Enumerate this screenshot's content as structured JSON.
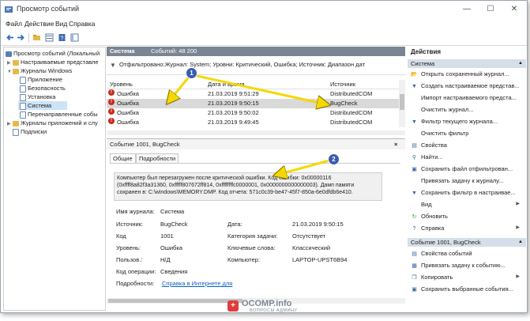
{
  "window": {
    "title": "Просмотр событий"
  },
  "menu": [
    "Файл",
    "Действие",
    "Вид",
    "Справка"
  ],
  "tree": {
    "root": "Просмотр событий (Локальный",
    "custom": "Настраиваемые представле",
    "windows_logs": "Журналы Windows",
    "app": "Приложение",
    "security": "Безопасность",
    "setup": "Установка",
    "system": "Система",
    "forwarded": "Перенаправленные собы",
    "apps_services": "Журналы приложений и слу",
    "subscriptions": "Подписки"
  },
  "center": {
    "log_name": "Система",
    "event_count": "Событий: 48 200",
    "filter": "Отфильтровано:Журнал: System; Уровни: Критический, Ошибка; Источник: Диапазон дат",
    "columns": {
      "level": "Уровень",
      "date": "Дата и время",
      "source": "Источник"
    },
    "rows": [
      {
        "level": "Ошибка",
        "date": "21.03.2019 9:51:29",
        "source": "DistributedCOM"
      },
      {
        "level": "Ошибка",
        "date": "21.03.2019 9:50:15",
        "source": "BugCheck"
      },
      {
        "level": "Ошибка",
        "date": "21.03.2019 9:50:02",
        "source": "DistributedCOM"
      },
      {
        "level": "Ошибка",
        "date": "21.03.2019 9:49:45",
        "source": "DistributedCOM"
      }
    ]
  },
  "detail": {
    "title": "Событие 1001, BugCheck",
    "close": "×",
    "tabs": [
      "Общие",
      "Подробности"
    ],
    "description": "Компьютер был перезагружен после критической ошибки. Код ошибки: 0x00000116 (0xffff8a82f3a31360, 0xfffff807672ff814, 0xffffffffc0000001, 0x0000000000000003). Дамп памяти сохранен в: C:\\windows\\MEMORY.DMP. Код отчета: 571c0c39-be47-45f7-850a-6e0dfdb6e410.",
    "fields": {
      "log_label": "Имя журнала:",
      "log_value": "Система",
      "source_label": "Источник:",
      "source_value": "BugCheck",
      "date_label": "Дата:",
      "date_value": "21.03.2019 9:50:15",
      "code_label": "Код",
      "code_value": "1001",
      "category_label": "Категория задачи:",
      "category_value": "Отсутствует",
      "level_label": "Уровень:",
      "level_value": "Ошибка",
      "keywords_label": "Ключевые слова:",
      "keywords_value": "Классический",
      "user_label": "Пользов.:",
      "user_value": "Н/Д",
      "computer_label": "Компьютер:",
      "computer_value": "LAPTOP-UPST6B94",
      "opcode_label": "Код операции:",
      "opcode_value": "Сведения",
      "more_label": "Подробности:",
      "more_link": "Справка в Интернете для"
    }
  },
  "actions": {
    "header": "Действия",
    "section1": "Система",
    "items1": [
      {
        "icon": "open-icon",
        "label": "Открыть сохраненный журнал..."
      },
      {
        "icon": "filter-create-icon",
        "label": "Создать настраиваемое представ..."
      },
      {
        "icon": "import-icon",
        "label": "Импорт настраиваемого предста..."
      },
      {
        "icon": "clear-icon",
        "label": "Очистить журнал..."
      },
      {
        "icon": "filter-icon",
        "label": "Фильтр текущего журнала..."
      },
      {
        "icon": "clear-filter-icon",
        "label": "Очистить фильтр"
      },
      {
        "icon": "properties-icon",
        "label": "Свойства"
      },
      {
        "icon": "find-icon",
        "label": "Найти..."
      },
      {
        "icon": "save-icon",
        "label": "Сохранить файл отфильтрован..."
      },
      {
        "icon": "attach-task-icon",
        "label": "Привязать задачу к журналу..."
      },
      {
        "icon": "save-filter-icon",
        "label": "Сохранить фильтр в настраиваe..."
      },
      {
        "icon": "view-icon",
        "label": "Вид"
      },
      {
        "icon": "refresh-icon",
        "label": "Обновить"
      },
      {
        "icon": "help-icon",
        "label": "Справка"
      }
    ],
    "section2": "Событие 1001, BugCheck",
    "items2": [
      {
        "icon": "event-properties-icon",
        "label": "Свойства событий"
      },
      {
        "icon": "attach-event-task-icon",
        "label": "Привязать задачу к событию..."
      },
      {
        "icon": "copy-icon",
        "label": "Копировать"
      },
      {
        "icon": "save-selected-icon",
        "label": "Сохранить выбранные события..."
      }
    ]
  },
  "annotations": {
    "badge1": "1",
    "badge2": "2"
  },
  "watermark": {
    "text": "OCOMP.info",
    "sub": "ВОПРОСЫ АДМИНУ"
  },
  "colors": {
    "accent": "#3b5bb0",
    "arrow": "#f5d800",
    "error": "#c42b1c"
  }
}
